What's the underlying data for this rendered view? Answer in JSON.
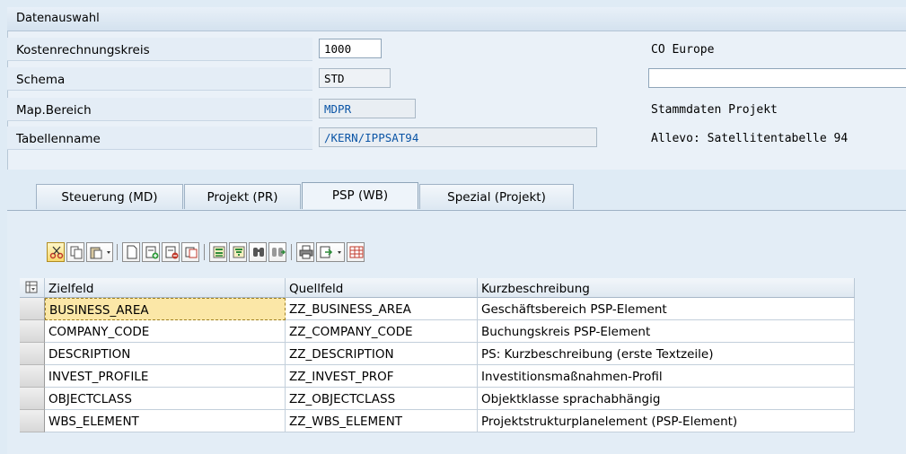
{
  "frame": {
    "title": "Datenauswahl"
  },
  "fields": [
    {
      "label": "Kostenrechnungskreis",
      "value": "1000",
      "desc": "CO Europe"
    },
    {
      "label": "Schema",
      "value": "STD",
      "desc": ""
    },
    {
      "label": "Map.Bereich",
      "value": "MDPR",
      "desc": "Stammdaten Projekt"
    },
    {
      "label": "Tabellenname",
      "value": "/KERN/IPPSAT94",
      "desc": "Allevo: Satellitentabelle 94"
    }
  ],
  "tabs": [
    {
      "label": "Steuerung (MD)"
    },
    {
      "label": "Projekt (PR)"
    },
    {
      "label": "PSP (WB)",
      "active": true
    },
    {
      "label": "Spezial (Projekt)"
    }
  ],
  "toolbar": {
    "icons": [
      "cut-icon",
      "copy-icon",
      "paste-icon",
      "new-row-icon",
      "insert-row-icon",
      "delete-row-icon",
      "copy-row-icon",
      "sort-asc-icon",
      "filter-icon",
      "find-icon",
      "find-next-icon",
      "print-icon",
      "export-icon",
      "layout-icon"
    ]
  },
  "grid": {
    "columns": [
      "Zielfeld",
      "Quellfeld",
      "Kurzbeschreibung"
    ],
    "rows": [
      [
        "BUSINESS_AREA",
        "ZZ_BUSINESS_AREA",
        "Geschäftsbereich PSP-Element"
      ],
      [
        "COMPANY_CODE",
        "ZZ_COMPANY_CODE",
        "Buchungskreis PSP-Element"
      ],
      [
        "DESCRIPTION",
        "ZZ_DESCRIPTION",
        "PS: Kurzbeschreibung (erste Textzeile)"
      ],
      [
        "INVEST_PROFILE",
        "ZZ_INVEST_PROF",
        "Investitionsmaßnahmen-Profil"
      ],
      [
        "OBJECTCLASS",
        "ZZ_OBJECTCLASS",
        "Objektklasse sprachabhängig"
      ],
      [
        "WBS_ELEMENT",
        "ZZ_WBS_ELEMENT",
        "Projektstrukturplanelement (PSP-Element)"
      ]
    ]
  },
  "colors": {
    "accent": "#0b55a6",
    "focus": "#fbe7a7"
  }
}
